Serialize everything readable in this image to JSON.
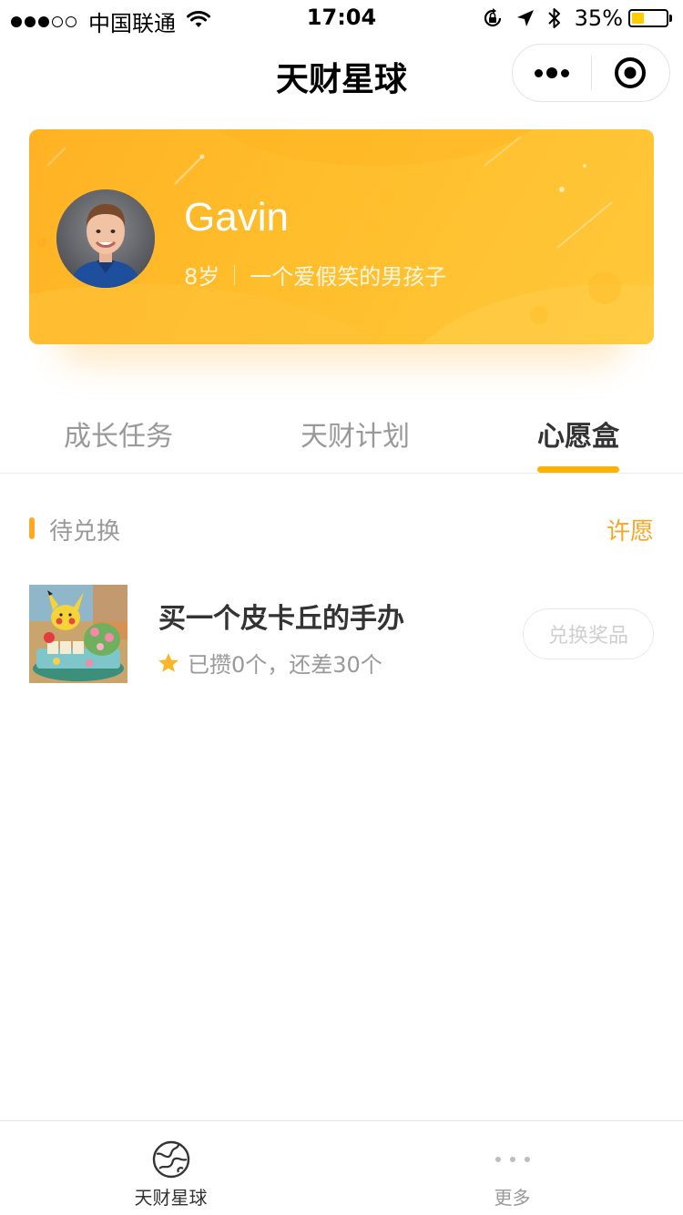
{
  "status_bar": {
    "carrier": "中国联通",
    "time": "17:04",
    "battery_percent": "35%",
    "battery_level": 0.35,
    "signal_bars_filled": 3,
    "signal_bars_total": 5
  },
  "nav": {
    "title": "天财星球",
    "more_icon": "more-dots-icon",
    "close_icon": "target-circle-icon"
  },
  "profile": {
    "name": "Gavin",
    "age": "8岁",
    "bio": "一个爱假笑的男孩子"
  },
  "tabs": [
    {
      "label": "成长任务",
      "active": false
    },
    {
      "label": "天财计划",
      "active": false
    },
    {
      "label": "心愿盒",
      "active": true
    }
  ],
  "section": {
    "title": "待兑换",
    "action": "许愿"
  },
  "wish_items": [
    {
      "title": "买一个皮卡丘的手办",
      "progress": "已攒0个，还差30个",
      "button": "兑换奖品",
      "icon": "star-icon"
    }
  ],
  "tabbar": [
    {
      "label": "天财星球",
      "icon": "planet-icon",
      "active": true
    },
    {
      "label": "更多",
      "icon": "more-dots-icon",
      "active": false
    }
  ],
  "colors": {
    "accent": "#ffb200",
    "card_gradient_start": "#ffb224",
    "card_gradient_end": "#ffc83a",
    "action_link": "#f5a623"
  }
}
